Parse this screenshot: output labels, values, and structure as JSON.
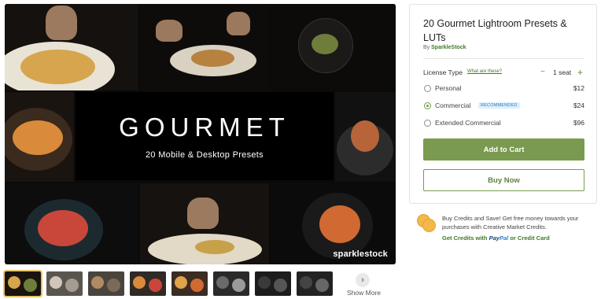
{
  "hero": {
    "title": "GOURMET",
    "subtitle": "20 Mobile & Desktop Presets",
    "watermark": "sparklestock"
  },
  "thumbnails": {
    "count": 8,
    "active_index": 0,
    "show_more_label": "Show More",
    "next_icon": "chevron-right-icon"
  },
  "product": {
    "title": "20 Gourmet Lightroom Presets & LUTs",
    "by_prefix": "By",
    "author": "SparkleStock"
  },
  "license": {
    "label": "License Type",
    "help_link": "What are these?",
    "quantity_minus": "−",
    "quantity": "1 seat",
    "quantity_plus": "+",
    "options": [
      {
        "label": "Personal",
        "price": "$12",
        "selected": false
      },
      {
        "label": "Commercial",
        "price": "$24",
        "selected": true,
        "badge": "RECOMMENDED"
      },
      {
        "label": "Extended Commercial",
        "price": "$96",
        "selected": false
      }
    ]
  },
  "actions": {
    "add_to_cart": "Add to Cart",
    "buy_now": "Buy Now"
  },
  "credits": {
    "text": "Buy Credits and Save! Get free money towards your purchases with Creative Market Credits.",
    "link_prefix": "Get Credits with",
    "paypal_a": "Pay",
    "paypal_b": "Pal",
    "link_suffix": "or Credit Card"
  },
  "colors": {
    "accent_green": "#7a9a4f",
    "link_green": "#3e7a27",
    "badge_blue": "#2d7ab8",
    "coin_gold": "#f2b84a"
  }
}
